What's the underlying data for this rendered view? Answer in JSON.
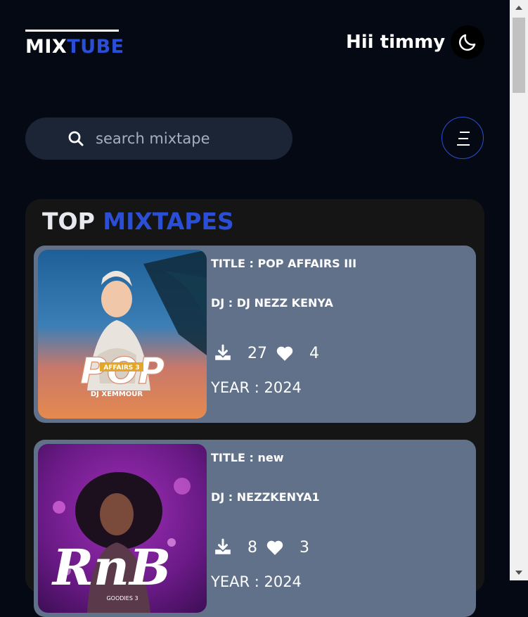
{
  "header": {
    "logo_part1": "MIX",
    "logo_part2": "TUBE",
    "greeting": "Hii timmy",
    "theme_icon": "moon-icon"
  },
  "search": {
    "placeholder": "search mixtape",
    "icon": "search-icon"
  },
  "menu": {
    "icon": "menu-icon"
  },
  "section": {
    "title_part1": "TOP",
    "title_part2": "MIXTAPES"
  },
  "mixtapes": [
    {
      "title": "TITLE : POP AFFAIRS III",
      "dj": "DJ : DJ NEZZ KENYA",
      "downloads": "27",
      "likes": "4",
      "year": "YEAR : 2024",
      "cover_label": "POP",
      "cover_sub": "AFFAIRS 3",
      "cover_dj": "DJ XEMMOUR"
    },
    {
      "title": "TITLE : new",
      "dj": "DJ : NEZZKENYA1",
      "downloads": "8",
      "likes": "3",
      "year": "YEAR : 2024",
      "cover_label": "RnB",
      "cover_sub": "GOODIES 3"
    }
  ],
  "colors": {
    "background": "#040914",
    "accent": "#2a4fd6",
    "card": "#617189",
    "panel": "#151515"
  }
}
